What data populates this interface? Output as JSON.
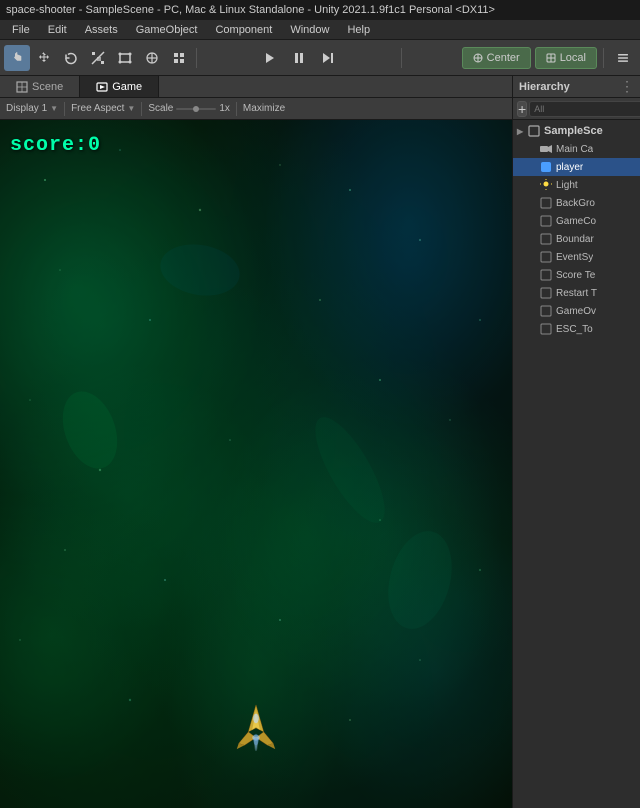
{
  "titleBar": {
    "text": "space-shooter - SampleScene - PC, Mac & Linux Standalone - Unity 2021.1.9f1c1 Personal <DX11>"
  },
  "menuBar": {
    "items": [
      "File",
      "Edit",
      "Assets",
      "GameObject",
      "Component",
      "Window",
      "Help"
    ]
  },
  "toolbar": {
    "tools": [
      "hand",
      "move",
      "rotate",
      "scale",
      "rect",
      "transform",
      "custom"
    ],
    "centerLabel": "Center",
    "localLabel": "Local",
    "rightIcon": "layers"
  },
  "tabs": {
    "scene": "Scene",
    "game": "Game"
  },
  "gameToolbar": {
    "displayLabel": "Display 1",
    "aspectLabel": "Free Aspect",
    "scaleLabel": "Scale",
    "scaleFactor": "1x",
    "maximizeLabel": "Maximize"
  },
  "viewport": {
    "scoreText": "score:0"
  },
  "hierarchy": {
    "panelTitle": "Hierarchy",
    "searchPlaceholder": "All",
    "addButtonLabel": "+",
    "items": [
      {
        "id": "sample-scene",
        "label": "SampleSce",
        "level": 0,
        "hasArrow": true,
        "type": "scene"
      },
      {
        "id": "main-camera",
        "label": "Main Ca",
        "level": 1,
        "hasArrow": false,
        "type": "camera"
      },
      {
        "id": "player",
        "label": "player",
        "level": 1,
        "hasArrow": false,
        "type": "object",
        "selected": true
      },
      {
        "id": "light",
        "label": "Light",
        "level": 1,
        "hasArrow": false,
        "type": "light"
      },
      {
        "id": "background",
        "label": "BackGro",
        "level": 1,
        "hasArrow": false,
        "type": "object"
      },
      {
        "id": "gamecontroller",
        "label": "GameCo",
        "level": 1,
        "hasArrow": false,
        "type": "object"
      },
      {
        "id": "boundary",
        "label": "Boundar",
        "level": 1,
        "hasArrow": false,
        "type": "object"
      },
      {
        "id": "eventsystem",
        "label": "EventSy",
        "level": 1,
        "hasArrow": false,
        "type": "object"
      },
      {
        "id": "scoretext",
        "label": "Score Te",
        "level": 1,
        "hasArrow": false,
        "type": "object"
      },
      {
        "id": "restarttext",
        "label": "Restart T",
        "level": 1,
        "hasArrow": false,
        "type": "object"
      },
      {
        "id": "gameoverpanel",
        "label": "GameOv",
        "level": 1,
        "hasArrow": false,
        "type": "object"
      },
      {
        "id": "esctext",
        "label": "ESC_To",
        "level": 1,
        "hasArrow": false,
        "type": "object"
      }
    ]
  },
  "icons": {
    "hand": "✋",
    "move": "✥",
    "rotate": "↺",
    "scale": "⤡",
    "rect": "▭",
    "transform": "⊕",
    "layers": "☰",
    "play": "▶",
    "pause": "⏸",
    "step": "⏭",
    "dots": "⋮"
  },
  "colors": {
    "accent": "#2b5289",
    "activeTab": "#282828",
    "scoreColor": "#00ffaa",
    "playerHighlight": "#4a9eff"
  }
}
